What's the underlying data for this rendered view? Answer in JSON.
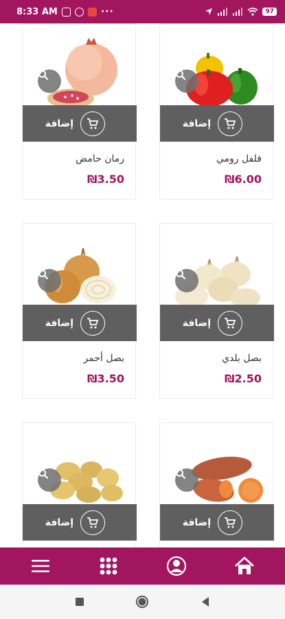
{
  "status_bar": {
    "time": "8:33 AM",
    "battery": "97",
    "more": "···"
  },
  "products": [
    {
      "name": "فلفل رومي",
      "price": "₪6.00",
      "add_label": "إضافة",
      "image": "bell-peppers"
    },
    {
      "name": "رمان حامض",
      "price": "₪3.50",
      "add_label": "إضافة",
      "image": "pomegranate"
    },
    {
      "name": "بصل بلدي",
      "price": "₪2.50",
      "add_label": "إضافة",
      "image": "white-onions"
    },
    {
      "name": "بصل أحمر",
      "price": "₪3.50",
      "add_label": "إضافة",
      "image": "brown-onions"
    },
    {
      "name": "",
      "price": "",
      "add_label": "إضافة",
      "image": "sweet-potatoes"
    },
    {
      "name": "",
      "price": "",
      "add_label": "إضافة",
      "image": "potatoes"
    }
  ],
  "bottom_nav": [
    {
      "icon": "home-icon"
    },
    {
      "icon": "user-icon"
    },
    {
      "icon": "grid-menu-icon"
    },
    {
      "icon": "hamburger-menu-icon"
    }
  ],
  "colors": {
    "brand": "#a2155f",
    "add_bar": "#5f5f5f"
  }
}
